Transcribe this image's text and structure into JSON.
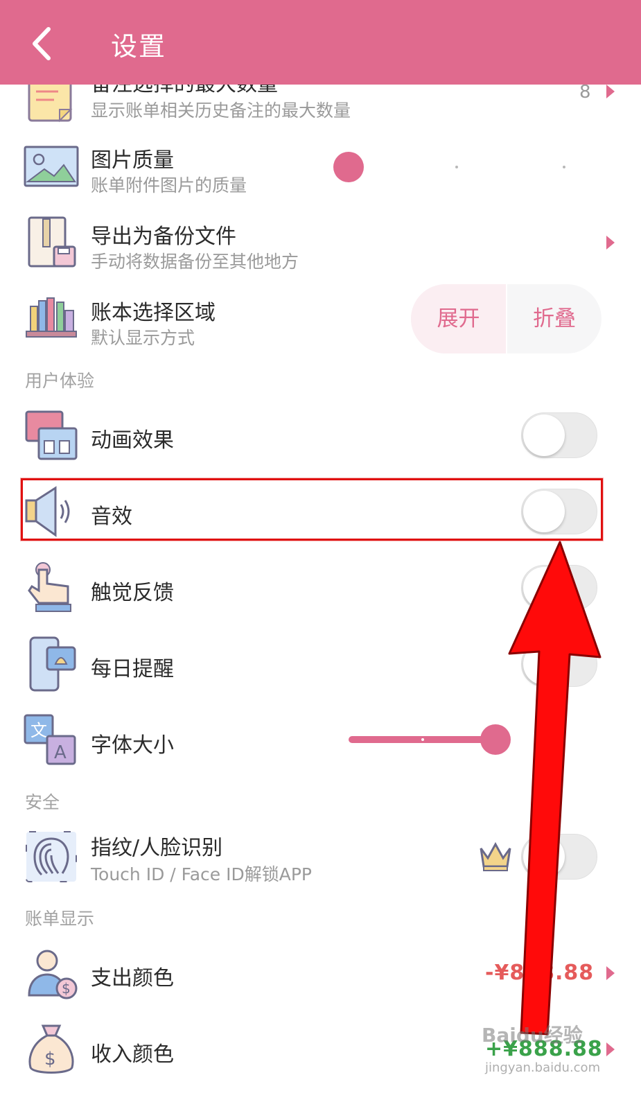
{
  "header": {
    "title": "设置",
    "back_icon": "chevron-left-icon",
    "background": "#e06a8e"
  },
  "accent": "#e06a8e",
  "rows": {
    "notes_max": {
      "title": "备注选择的最大数量",
      "subtitle": "显示账单相关历史备注的最大数量",
      "value": "8",
      "icon": "note-icon"
    },
    "image_quality": {
      "title": "图片质量",
      "subtitle": "账单附件图片的质量",
      "icon": "picture-icon",
      "slider_level": 0
    },
    "export_backup": {
      "title": "导出为备份文件",
      "subtitle": "手动将数据备份至其他地方",
      "icon": "backup-file-icon"
    },
    "book_region": {
      "title": "账本选择区域",
      "subtitle": "默认显示方式",
      "icon": "bookshelf-icon",
      "options": [
        "展开",
        "折叠"
      ],
      "selected": "展开"
    },
    "animation": {
      "title": "动画效果",
      "icon": "animation-icon",
      "enabled": false
    },
    "sound": {
      "title": "音效",
      "icon": "speaker-icon",
      "enabled": false
    },
    "haptic": {
      "title": "触觉反馈",
      "icon": "touch-icon",
      "enabled": false
    },
    "reminder": {
      "title": "每日提醒",
      "icon": "phone-bell-icon",
      "enabled": false
    },
    "font_size": {
      "title": "字体大小",
      "icon": "translate-icon",
      "slider_level": 0.67
    },
    "biometric": {
      "title": "指纹/人脸识别",
      "subtitle": "Touch ID / Face ID解锁APP",
      "icon": "fingerprint-icon",
      "badge_icon": "crown-icon",
      "enabled": false
    },
    "expense_color": {
      "title": "支出颜色",
      "value": "-¥888.88",
      "value_color": "#e55b5b",
      "icon": "person-money-icon"
    },
    "income_color": {
      "title": "收入颜色",
      "value": "+¥888.88",
      "value_color": "#3aa24a",
      "icon": "money-bag-icon"
    }
  },
  "sections": {
    "user_experience": "用户体验",
    "security": "安全",
    "bill_display": "账单显示"
  },
  "watermark": {
    "main": "Baidu经验",
    "sub": "jingyan.baidu.com"
  }
}
